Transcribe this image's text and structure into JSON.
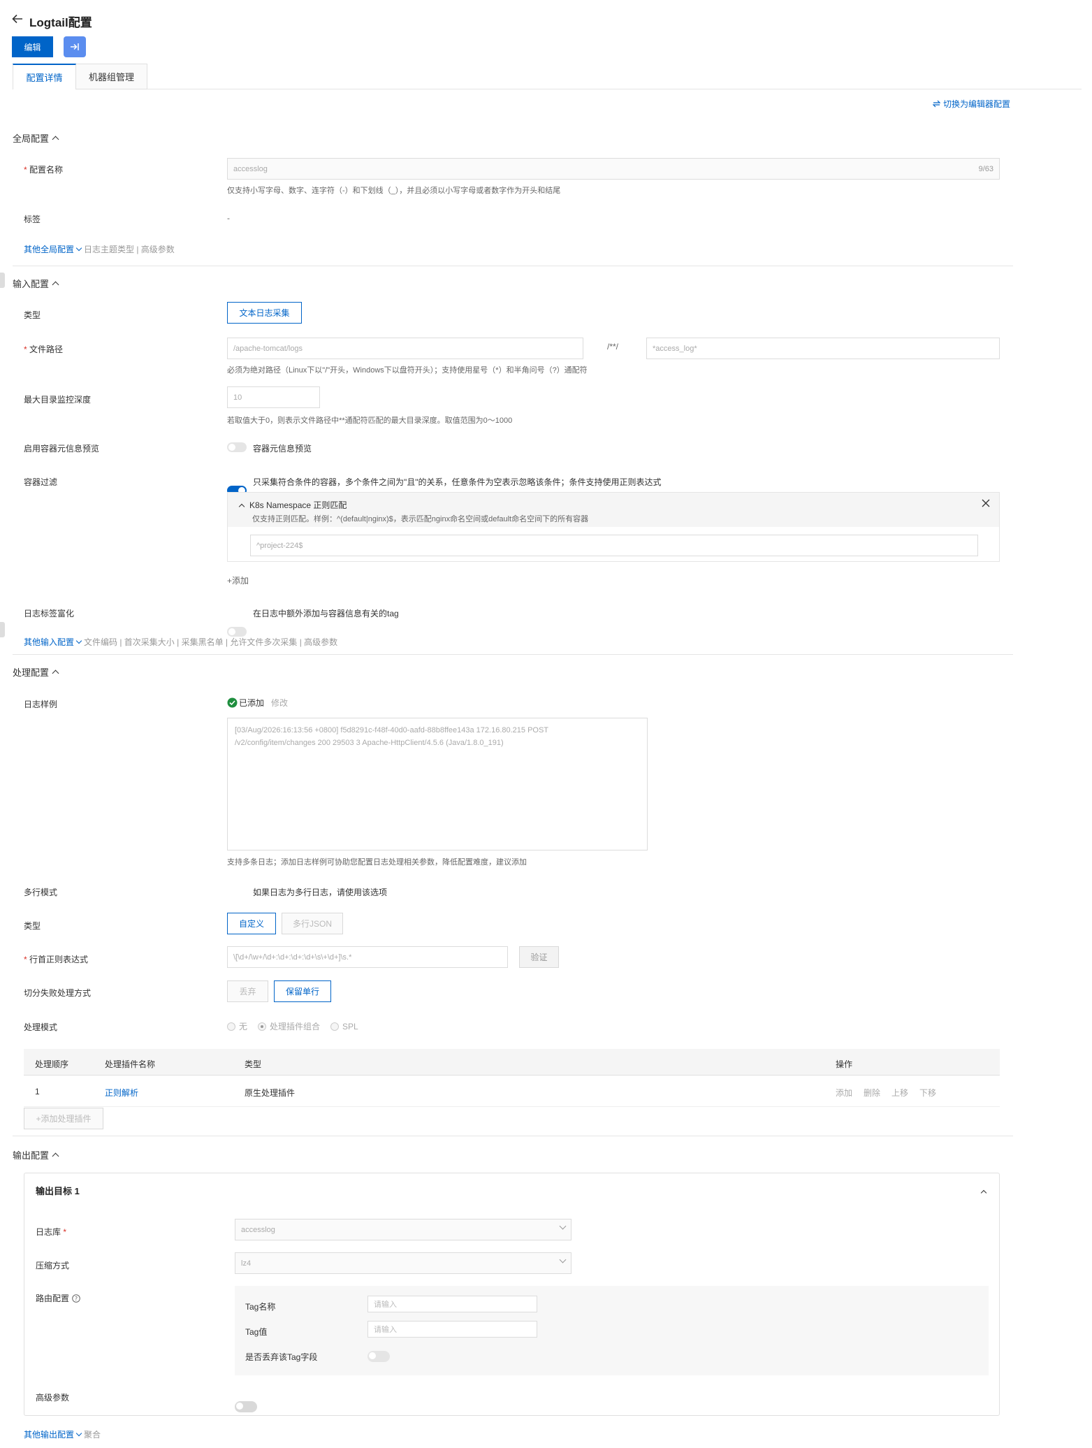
{
  "header": {
    "back_icon": "arrow-left-icon",
    "title": "Logtail配置",
    "edit_label": "编辑",
    "export_icon": "arrow-right-to-bar-icon"
  },
  "tabs": [
    {
      "label": "配置详情",
      "active": true
    },
    {
      "label": "机器组管理",
      "active": false
    }
  ],
  "switch_editor_label": "切换为编辑器配置",
  "global": {
    "title": "全局配置",
    "config_name_label": "配置名称",
    "config_name_value": "accesslog",
    "config_name_count": "9/63",
    "config_name_hint": "仅支持小写字母、数字、连字符（-）和下划线（_），并且必须以小写字母或者数字作为开头和结尾",
    "tags_label": "标签",
    "tags_value": "-",
    "other_label": "其他全局配置",
    "other_items": "日志主题类型 | 高级参数"
  },
  "input": {
    "title": "输入配置",
    "type_label": "类型",
    "type_value": "文本日志采集",
    "file_path_label": "文件路径",
    "file_path_dir": "/apache-tomcat/logs",
    "file_path_sep": "/**/",
    "file_path_name": "*access_log*",
    "file_path_hint": "必须为绝对路径（Linux下以\"/\"开头，Windows下以盘符开头）；支持使用星号（*）和半角问号（?）通配符",
    "max_depth_label": "最大目录监控深度",
    "max_depth_value": "10",
    "max_depth_hint": "若取值大于0，则表示文件路径中**通配符匹配的最大目录深度。取值范围为0～1000",
    "container_meta_label": "启用容器元信息预览",
    "container_meta_toggle": "容器元信息预览",
    "container_filter_label": "容器过滤",
    "container_filter_toggle": "只采集符合条件的容器，多个条件之间为\"且\"的关系，任意条件为空表示忽略该条件；条件支持使用正则表达式",
    "k8s_title": "K8s Namespace 正则匹配",
    "k8s_hint": "仅支持正则匹配。样例：^(default|nginx)$，表示匹配nginx命名空间或default命名空间下的所有容器",
    "k8s_value": "^project-224$",
    "add_label": "+添加",
    "tag_enrich_label": "日志标签富化",
    "tag_enrich_toggle": "在日志中额外添加与容器信息有关的tag",
    "other_label": "其他输入配置",
    "other_items": "文件编码 | 首次采集大小 | 采集黑名单 | 允许文件多次采集 | 高级参数"
  },
  "process": {
    "title": "处理配置",
    "sample_label": "日志样例",
    "sample_status": "已添加",
    "sample_edit": "修改",
    "sample_line1": "[03/Aug/2026:16:13:56 +0800] f5d8291c-f48f-40d0-aafd-88b8ffee143a 172.16.80.215 POST",
    "sample_line2": "/v2/config/item/changes 200 29503 3 Apache-HttpClient/4.5.6 (Java/1.8.0_191)",
    "sample_hint": "支持多条日志；添加日志样例可协助您配置日志处理相关参数，降低配置难度，建议添加",
    "multiline_label": "多行模式",
    "multiline_toggle": "如果日志为多行日志，请使用该选项",
    "type_label": "类型",
    "type_custom": "自定义",
    "type_json": "多行JSON",
    "regex_label": "行首正则表达式",
    "regex_value": "\\[\\d+/\\w+/\\d+:\\d+:\\d+:\\d+\\s\\+\\d+]\\s.*",
    "verify_label": "验证",
    "fail_label": "切分失败处理方式",
    "fail_discard": "丢弃",
    "fail_keep": "保留单行",
    "mode_label": "处理模式",
    "mode_options": [
      "无",
      "处理插件组合",
      "SPL"
    ],
    "table_headers": [
      "处理顺序",
      "处理插件名称",
      "类型",
      "操作"
    ],
    "table_rows": [
      {
        "order": "1",
        "name": "正则解析",
        "type": "原生处理插件"
      }
    ],
    "row_actions": [
      "添加",
      "删除",
      "上移",
      "下移"
    ],
    "add_plugin_label": "+添加处理插件"
  },
  "output": {
    "title": "输出配置",
    "target_title": "输出目标 1",
    "logstore_label": "日志库",
    "logstore_value": "accesslog",
    "compress_label": "压缩方式",
    "compress_value": "lz4",
    "route_label": "路由配置",
    "tag_name_label": "Tag名称",
    "tag_name_placeholder": "请输入",
    "tag_value_label": "Tag值",
    "tag_value_placeholder": "请输入",
    "discard_tag_label": "是否丢弃该Tag字段",
    "advanced_label": "高级参数",
    "other_label": "其他输出配置",
    "other_items": "聚合"
  },
  "colors": {
    "primary": "#0064c8",
    "success": "#1e8e3e",
    "required": "#d93026"
  }
}
